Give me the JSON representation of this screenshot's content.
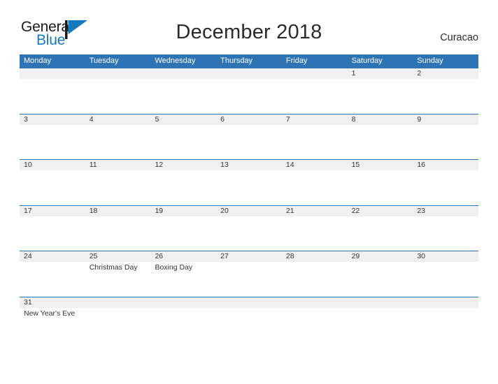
{
  "brand": {
    "name_part1": "General",
    "name_part2": "Blue",
    "flag_icon": "flag-icon",
    "flag_color": "#1479bd",
    "pole_color": "#1a1a1a"
  },
  "header": {
    "title": "December 2018",
    "region": "Curacao"
  },
  "colors": {
    "header_blue": "#2e73b4",
    "row_divider_blue": "#2e73b4",
    "date_band_gray": "#f0f0f0",
    "text": "#333333"
  },
  "calendar": {
    "month": "December",
    "year": "2018",
    "weekday_headers": [
      "Monday",
      "Tuesday",
      "Wednesday",
      "Thursday",
      "Friday",
      "Saturday",
      "Sunday"
    ],
    "weeks": [
      {
        "days": [
          {
            "date": "",
            "event": ""
          },
          {
            "date": "",
            "event": ""
          },
          {
            "date": "",
            "event": ""
          },
          {
            "date": "",
            "event": ""
          },
          {
            "date": "",
            "event": ""
          },
          {
            "date": "1",
            "event": ""
          },
          {
            "date": "2",
            "event": ""
          }
        ]
      },
      {
        "days": [
          {
            "date": "3",
            "event": ""
          },
          {
            "date": "4",
            "event": ""
          },
          {
            "date": "5",
            "event": ""
          },
          {
            "date": "6",
            "event": ""
          },
          {
            "date": "7",
            "event": ""
          },
          {
            "date": "8",
            "event": ""
          },
          {
            "date": "9",
            "event": ""
          }
        ]
      },
      {
        "days": [
          {
            "date": "10",
            "event": ""
          },
          {
            "date": "11",
            "event": ""
          },
          {
            "date": "12",
            "event": ""
          },
          {
            "date": "13",
            "event": ""
          },
          {
            "date": "14",
            "event": ""
          },
          {
            "date": "15",
            "event": ""
          },
          {
            "date": "16",
            "event": ""
          }
        ]
      },
      {
        "days": [
          {
            "date": "17",
            "event": ""
          },
          {
            "date": "18",
            "event": ""
          },
          {
            "date": "19",
            "event": ""
          },
          {
            "date": "20",
            "event": ""
          },
          {
            "date": "21",
            "event": ""
          },
          {
            "date": "22",
            "event": ""
          },
          {
            "date": "23",
            "event": ""
          }
        ]
      },
      {
        "days": [
          {
            "date": "24",
            "event": ""
          },
          {
            "date": "25",
            "event": "Christmas Day"
          },
          {
            "date": "26",
            "event": "Boxing Day"
          },
          {
            "date": "27",
            "event": ""
          },
          {
            "date": "28",
            "event": ""
          },
          {
            "date": "29",
            "event": ""
          },
          {
            "date": "30",
            "event": ""
          }
        ]
      },
      {
        "days": [
          {
            "date": "31",
            "event": "New Year's Eve"
          },
          {
            "date": "",
            "event": ""
          },
          {
            "date": "",
            "event": ""
          },
          {
            "date": "",
            "event": ""
          },
          {
            "date": "",
            "event": ""
          },
          {
            "date": "",
            "event": ""
          },
          {
            "date": "",
            "event": ""
          }
        ]
      }
    ]
  }
}
